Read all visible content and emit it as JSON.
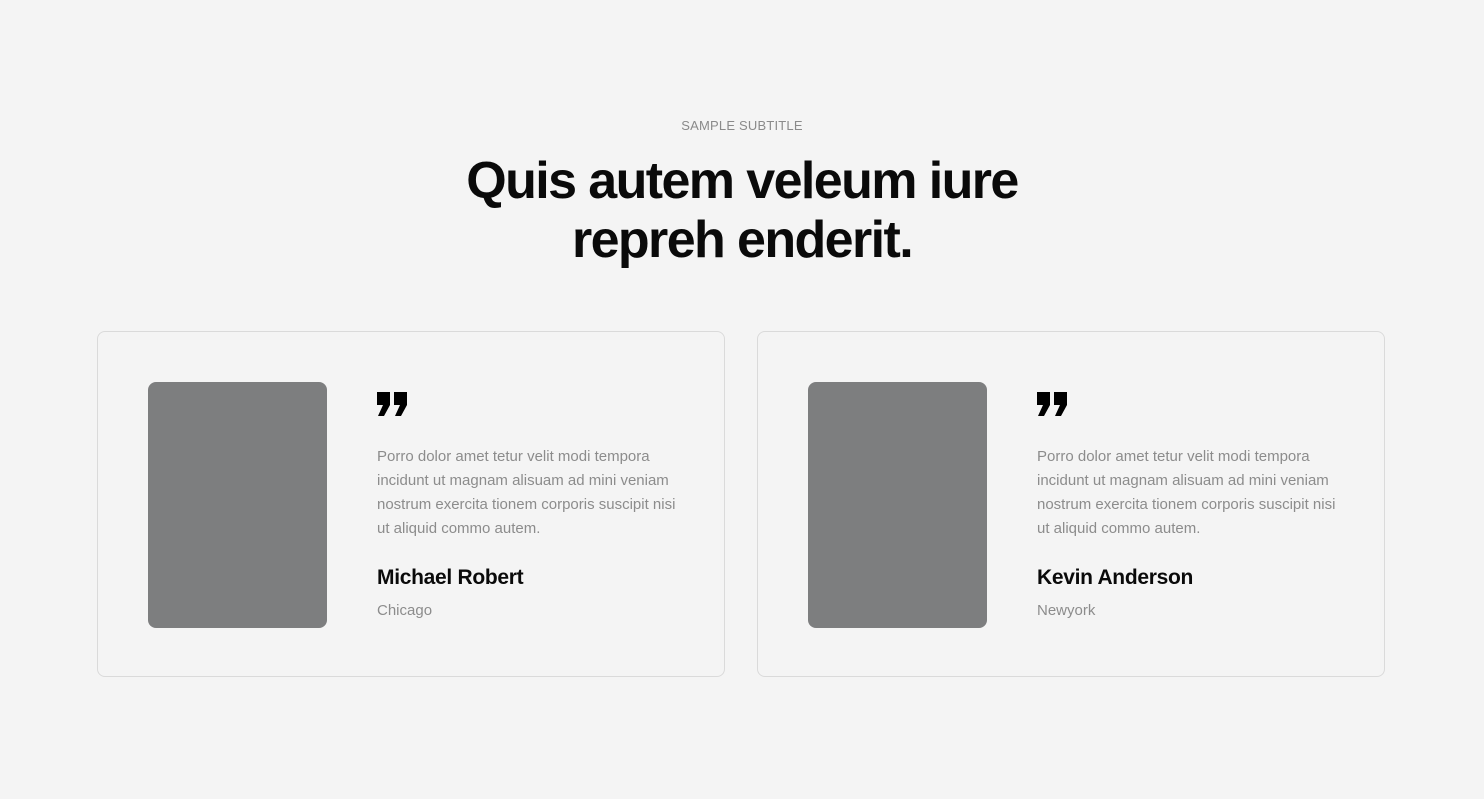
{
  "section": {
    "subtitle": "SAMPLE SUBTITLE",
    "title_line1": "Quis autem veleum iure",
    "title_line2": "repreh enderit."
  },
  "testimonials": [
    {
      "quote": "Porro dolor amet tetur velit modi tempora incidunt ut magnam alisuam ad mini veniam nostrum exercita tionem corporis suscipit nisi ut aliquid commo autem.",
      "name": "Michael Robert",
      "location": "Chicago"
    },
    {
      "quote": "Porro dolor amet tetur velit modi tempora incidunt ut magnam alisuam ad mini veniam nostrum exercita tionem corporis suscipit nisi ut aliquid commo autem.",
      "name": "Kevin Anderson",
      "location": "Newyork"
    }
  ],
  "icons": {
    "quote": "quote-icon"
  },
  "colors": {
    "background": "#f4f4f4",
    "photo_placeholder": "#7d7e7f",
    "muted_text": "#8c8c8c",
    "card_border": "#dadada"
  }
}
